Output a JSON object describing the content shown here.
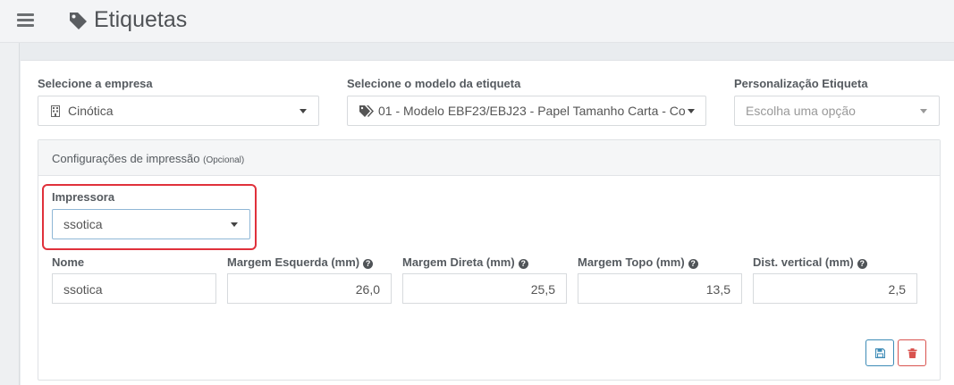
{
  "header": {
    "title": "Etiquetas",
    "menu_icon": "hamburger-menu-icon",
    "title_icon": "tag-icon"
  },
  "form": {
    "empresa": {
      "label": "Selecione a empresa",
      "value": "Cinótica",
      "icon": "building-icon"
    },
    "modelo": {
      "label": "Selecione o modelo da etiqueta",
      "value": "01 - Modelo EBF23/EBJ23 - Papel Tamanho Carta - Co",
      "icon": "tags-icon"
    },
    "personalizacao": {
      "label": "Personalização Etiqueta",
      "placeholder": "Escolha uma opção"
    }
  },
  "config": {
    "title": "Configurações de impressão",
    "optional": "(Opcional)",
    "impressora": {
      "label": "Impressora",
      "value": "ssotica"
    },
    "fields": {
      "nome": {
        "label": "Nome",
        "value": "ssotica"
      },
      "margem_esquerda": {
        "label": "Margem Esquerda (mm)",
        "value": "26,0"
      },
      "margem_direita": {
        "label": "Margem Direta (mm)",
        "value": "25,5"
      },
      "margem_topo": {
        "label": "Margem Topo (mm)",
        "value": "13,5"
      },
      "dist_vertical": {
        "label": "Dist. vertical (mm)",
        "value": "2,5"
      }
    },
    "help_icon": "question-circle-icon",
    "save_icon": "floppy-disk-icon",
    "delete_icon": "trash-icon"
  },
  "colors": {
    "highlight": "#e0313b",
    "save_border": "#3d8bb6",
    "delete_border": "#d9534f"
  }
}
